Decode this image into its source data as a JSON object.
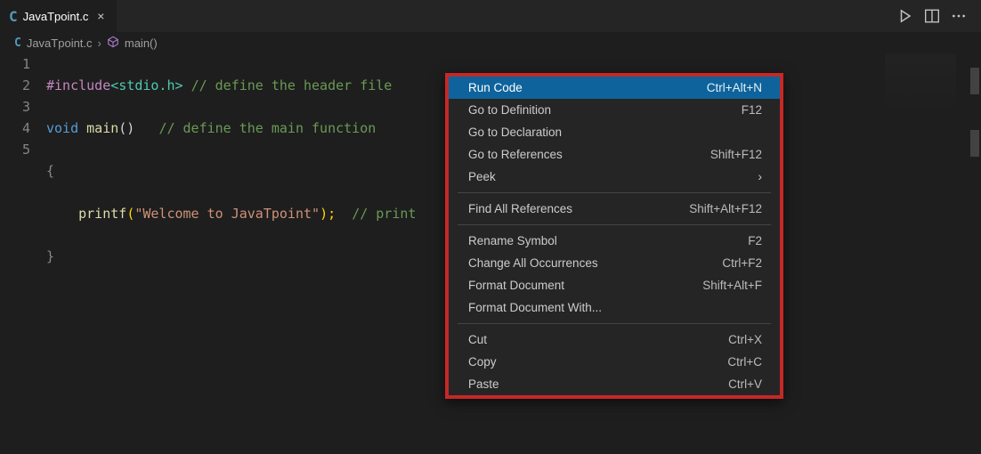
{
  "tab": {
    "label": "JavaTpoint.c"
  },
  "breadcrumb": {
    "file": "JavaTpoint.c",
    "symbol": "main()"
  },
  "code": {
    "lines": [
      "1",
      "2",
      "3",
      "4",
      "5"
    ],
    "l1": {
      "include": "#include",
      "hdr": "<stdio.h>",
      "com": "// define the header file"
    },
    "l2": {
      "type": "void",
      "fn": "main",
      "paren": "()",
      "com": "// define the main function"
    },
    "l3": {
      "br": "{"
    },
    "l4": {
      "fn": "printf",
      "open": "(",
      "str": "\"Welcome to JavaTpoint\"",
      "close": ");",
      "com": "// print"
    },
    "l5": {
      "br": "}"
    }
  },
  "menu": {
    "runCode": {
      "label": "Run Code",
      "kbd": "Ctrl+Alt+N"
    },
    "goDef": {
      "label": "Go to Definition",
      "kbd": "F12"
    },
    "goDecl": {
      "label": "Go to Declaration",
      "kbd": ""
    },
    "goRef": {
      "label": "Go to References",
      "kbd": "Shift+F12"
    },
    "peek": {
      "label": "Peek",
      "kbd": ""
    },
    "findAll": {
      "label": "Find All References",
      "kbd": "Shift+Alt+F12"
    },
    "rename": {
      "label": "Rename Symbol",
      "kbd": "F2"
    },
    "chgAll": {
      "label": "Change All Occurrences",
      "kbd": "Ctrl+F2"
    },
    "fmtDoc": {
      "label": "Format Document",
      "kbd": "Shift+Alt+F"
    },
    "fmtWith": {
      "label": "Format Document With...",
      "kbd": ""
    },
    "cut": {
      "label": "Cut",
      "kbd": "Ctrl+X"
    },
    "copy": {
      "label": "Copy",
      "kbd": "Ctrl+C"
    },
    "paste": {
      "label": "Paste",
      "kbd": "Ctrl+V"
    }
  }
}
